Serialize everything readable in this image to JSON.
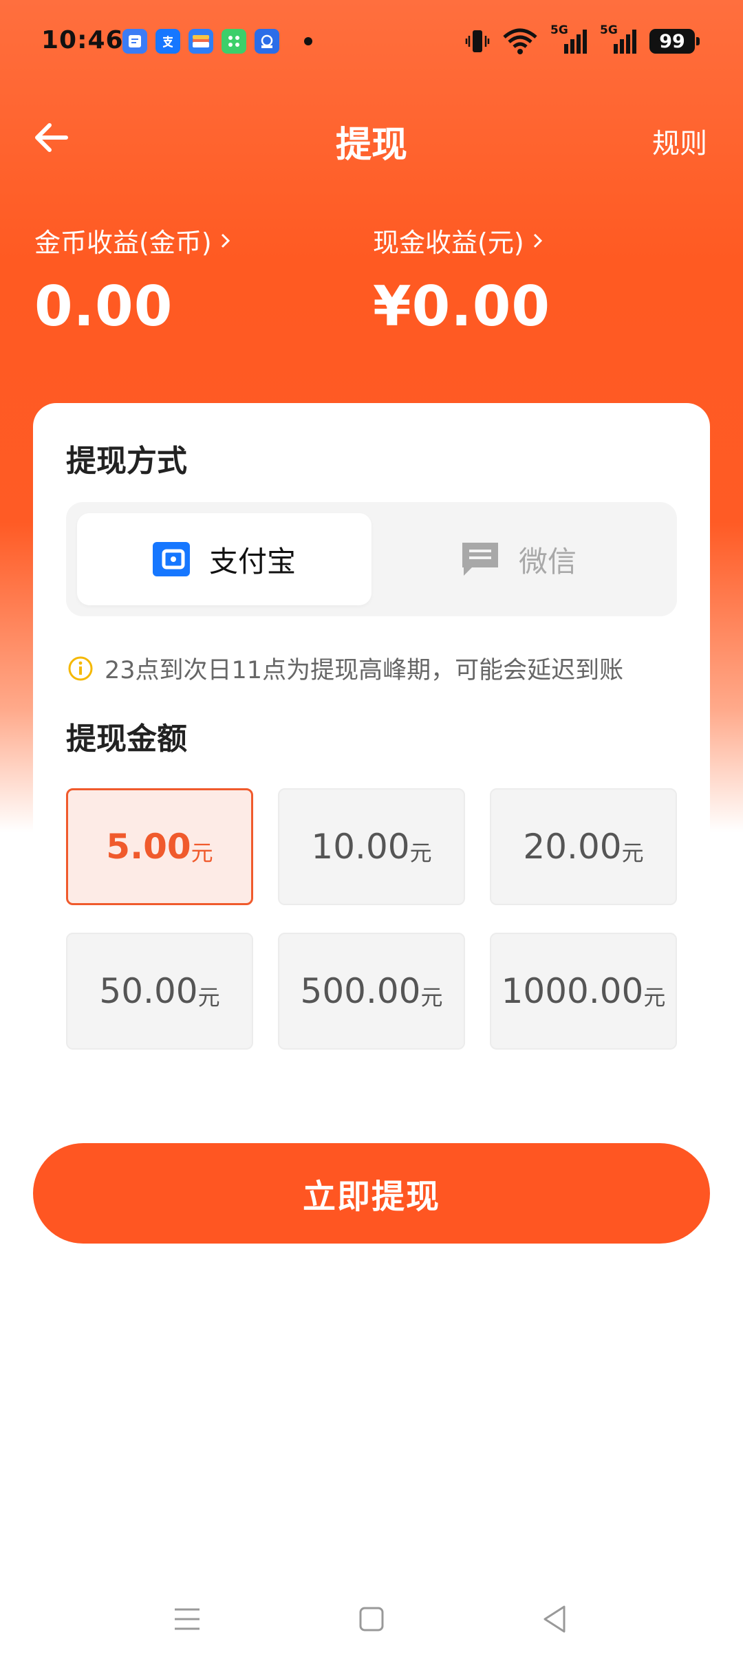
{
  "status_bar": {
    "time": "10:46",
    "battery": "99",
    "notification_icons": [
      "note-app-icon",
      "alipay-app-icon",
      "wallet-app-icon",
      "grid-app-icon",
      "person-app-icon"
    ],
    "network_labels": [
      "5G",
      "5G"
    ]
  },
  "header": {
    "title": "提现",
    "rules_label": "规则"
  },
  "balances": {
    "coins": {
      "label": "金币收益(金币)",
      "value": "0.00"
    },
    "cash": {
      "label": "现金收益(元)",
      "value": "¥0.00"
    }
  },
  "method_section": {
    "title": "提现方式",
    "options": [
      {
        "label": "支付宝",
        "icon": "wallet-icon",
        "selected": true
      },
      {
        "label": "微信",
        "icon": "chat-icon",
        "selected": false
      }
    ]
  },
  "notice": {
    "text": "23点到次日11点为提现高峰期，可能会延迟到账"
  },
  "amount_section": {
    "title": "提现金额",
    "unit": "元",
    "options": [
      {
        "value": "5.00",
        "selected": true
      },
      {
        "value": "10.00",
        "selected": false
      },
      {
        "value": "20.00",
        "selected": false
      },
      {
        "value": "50.00",
        "selected": false
      },
      {
        "value": "500.00",
        "selected": false
      },
      {
        "value": "1000.00",
        "selected": false
      }
    ]
  },
  "submit_label": "立即提现",
  "colors": {
    "accent": "#ff5622",
    "selected_border": "#f05a2c",
    "selected_bg": "#fdebe6",
    "alipay_blue": "#1677ff",
    "notice_icon": "#f5b800"
  }
}
